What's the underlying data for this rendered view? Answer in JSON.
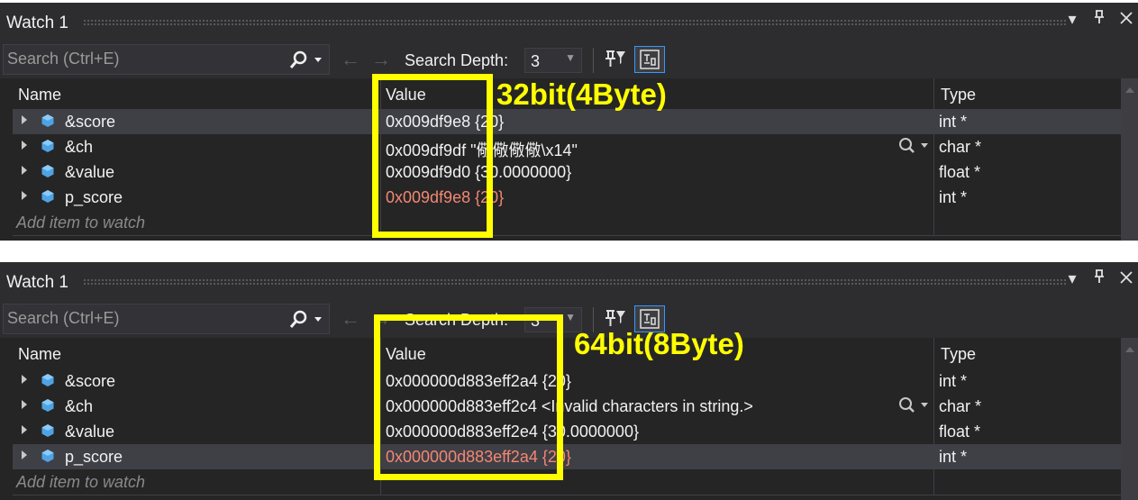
{
  "panels": [
    {
      "title": "Watch 1",
      "search_placeholder": "Search (Ctrl+E)",
      "search_depth_label": "Search Depth:",
      "search_depth_value": "3",
      "columns": {
        "name": "Name",
        "value": "Value",
        "type": "Type"
      },
      "rows": [
        {
          "name": "&score",
          "value": "0x009df9e8 {20}",
          "type": "int *",
          "changed": false,
          "selected": true,
          "magnifier": false
        },
        {
          "name": "&ch",
          "value": "0x009df9df \"儆儆儆儆\\x14\"",
          "type": "char *",
          "changed": false,
          "selected": false,
          "magnifier": true
        },
        {
          "name": "&value",
          "value": "0x009df9d0 {30.0000000}",
          "type": "float *",
          "changed": false,
          "selected": false,
          "magnifier": false
        },
        {
          "name": "p_score",
          "value": "0x009df9e8 {20}",
          "type": "int *",
          "changed": true,
          "selected": false,
          "magnifier": false
        }
      ],
      "add_item_placeholder": "Add item to watch",
      "annotation": "32bit(4Byte)"
    },
    {
      "title": "Watch 1",
      "search_placeholder": "Search (Ctrl+E)",
      "search_depth_label": "Search Depth:",
      "search_depth_value": "3",
      "columns": {
        "name": "Name",
        "value": "Value",
        "type": "Type"
      },
      "rows": [
        {
          "name": "&score",
          "value": "0x000000d883eff2a4 {20}",
          "type": "int *",
          "changed": false,
          "selected": false,
          "magnifier": false
        },
        {
          "name": "&ch",
          "value": "0x000000d883eff2c4 <Invalid characters in string.>",
          "type": "char *",
          "changed": false,
          "selected": false,
          "magnifier": true
        },
        {
          "name": "&value",
          "value": "0x000000d883eff2e4 {30.0000000}",
          "type": "float *",
          "changed": false,
          "selected": false,
          "magnifier": false
        },
        {
          "name": "p_score",
          "value": "0x000000d883eff2a4 {20}",
          "type": "int *",
          "changed": true,
          "selected": true,
          "magnifier": false
        }
      ],
      "add_item_placeholder": "Add item to watch",
      "annotation": "64bit(8Byte)"
    }
  ],
  "colors": {
    "panel_bg": "#252526",
    "toolbar_bg": "#2d2d30",
    "selected_row": "#3f3f46",
    "changed_value": "#f48771",
    "object_icon": "#4fa3e3",
    "highlight": "#ffff00",
    "accent": "#3399ff"
  },
  "icons": [
    "dropdown-icon",
    "pin-icon",
    "close-icon",
    "search-icon",
    "back-arrow-icon",
    "forward-arrow-icon",
    "filter-pin-icon",
    "tab-icon",
    "expander-icon",
    "object-icon",
    "magnifier-icon"
  ]
}
